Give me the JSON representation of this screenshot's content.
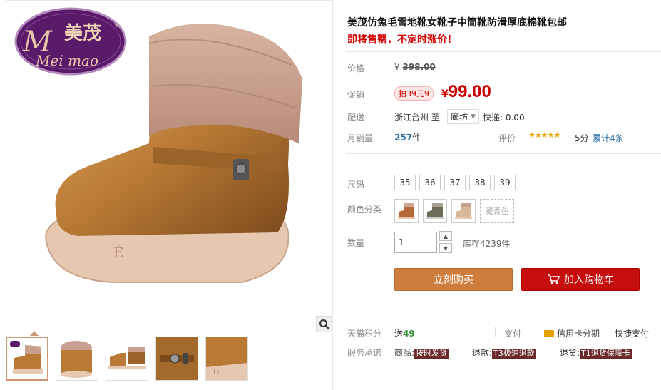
{
  "brand": {
    "logo_text_cn": "美茂",
    "logo_text_en": "Mei mao",
    "registered": "®"
  },
  "product": {
    "title": "美茂仿兔毛雪地靴女靴子中筒靴防滑厚底棉靴包邮",
    "subtitle": "即将售罄，不定时涨价！"
  },
  "price": {
    "label": "价格",
    "currency": "¥",
    "original": "398.00"
  },
  "promo": {
    "label": "促销",
    "badge": "拍39元9",
    "currency": "¥",
    "price": "99.00"
  },
  "shipping": {
    "label": "配送",
    "from": "浙江台州",
    "to_word": "至",
    "destination": "廊坊",
    "fee": "快递: 0.00"
  },
  "sales": {
    "label": "月销量",
    "count": "257",
    "unit": "件",
    "review_label": "评价",
    "stars": "★★★★★",
    "score": "5分",
    "review_count": "累计4条"
  },
  "size": {
    "label": "尺码",
    "options": [
      "35",
      "36",
      "37",
      "38",
      "39"
    ]
  },
  "color": {
    "label": "颜色分类",
    "text_option": "藏青色"
  },
  "quantity": {
    "label": "数量",
    "value": "1",
    "stock": "库存4239件",
    "up": "▲",
    "down": "▼"
  },
  "buttons": {
    "buy": "立刻购买",
    "cart": "加入购物车",
    "cart_icon": "cart-icon"
  },
  "points": {
    "label": "天猫积分",
    "prefix": "送",
    "value": "49"
  },
  "payment": {
    "label": "支付",
    "credit": "信用卡分期",
    "quick": "快捷支付"
  },
  "service": {
    "label": "服务承诺",
    "goods_label": "商品:",
    "goods_tag": "按时发货",
    "refund_label": "退款:",
    "refund_tag": "T3极速退款",
    "return_label": "退货:",
    "return_tag": "T1退货保障卡"
  },
  "colors": {
    "accent_red": "#c70e0e",
    "buy_orange": "#cf7d3c",
    "price_red": "#cc0000",
    "link_blue": "#2b6ea6"
  }
}
